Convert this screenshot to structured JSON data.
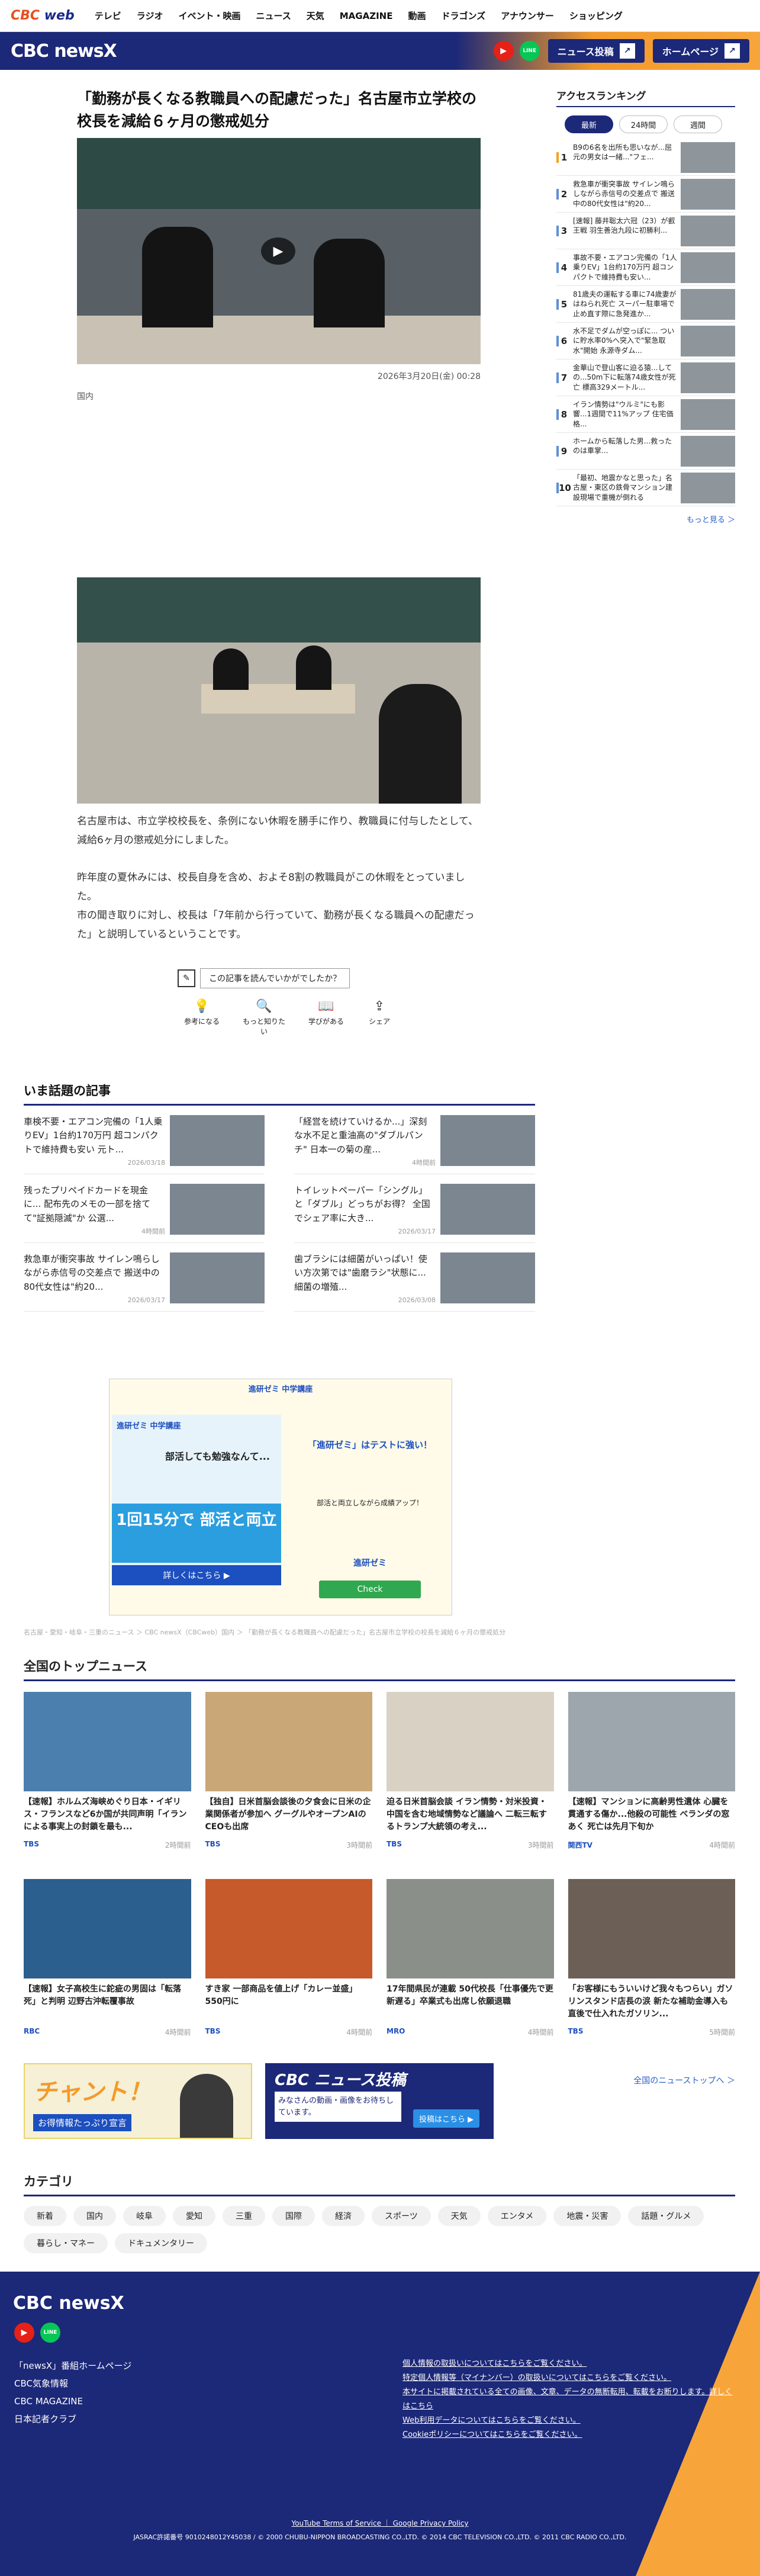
{
  "nav": {
    "logo": "CBC",
    "logo_web": "web",
    "items": [
      "テレビ",
      "ラジオ",
      "イベント・映画",
      "ニュース",
      "天気",
      "MAGAZINE",
      "動画",
      "ドラゴンズ",
      "アナウンサー",
      "ショッピング"
    ]
  },
  "header": {
    "logo": "CBC newsX",
    "youtube": "▶",
    "line": "LINE",
    "news_post": "ニュース投稿",
    "home": "ホームページ"
  },
  "article": {
    "title": "「勤務が長くなる教職員への配慮だった」名古屋市立学校の校長を減給６ヶ月の懲戒処分",
    "date": "2026年3月20日(金) 00:28",
    "category": "国内",
    "paragraphs": [
      "名古屋市は、市立学校校長を、条例にない休暇を勝手に作り、教職員に付与したとして、減給6ヶ月の懲戒処分にしました。",
      "昨年度の夏休みには、校長自身を含め、およそ8割の教職員がこの休暇をとっていました。",
      "市の聞き取りに対し、校長は「7年前から行っていて、勤務が長くなる職員への配慮だった」と説明しているということです。"
    ],
    "reaction_q": "この記事を読んでいかがでしたか？",
    "reactions": [
      "参考になる",
      "もっと知りたい",
      "学びがある",
      "シェア"
    ]
  },
  "sidebar": {
    "title": "アクセスランキング",
    "tabs": [
      "最新",
      "24時間",
      "週間"
    ],
    "ranking": [
      "B9の6名を出所も思いなが...屈元の男女は一緒...\"フェ...",
      "救急車が衝突事故 サイレン鳴らしながら赤信号の交差点で 搬送中の80代女性は\"約20...",
      "[速報] 藤井聡太六冠（23）が叡王戦 羽生善治九段に初勝利...",
      "事故不要・エアコン完備の「1人乗りEV」1台約170万円 超コンパクトで維持費も安い...",
      "81歳夫の運転する車に74歳妻がはねられ死亡 スーパー駐車場で止め直す際に急発進か...",
      "水不足でダムが空っぽに... ついに貯水率0%へ突入で\"緊急取水\"開始 永源寺ダム...",
      "金華山で登山客に迫る猿...しての...50m下に転落74歳女性が死亡 標高329メートル...",
      "イラン情勢は\"ウルミ\"にも影響...1週間で11%アップ 住宅価格...",
      "ホームから転落した男...救ったのは車掌...",
      "「最初、地震かなと思った」名古屋・東区の鉄骨マンション建設現場で重機が倒れる"
    ],
    "more": "もっと見る ＞"
  },
  "trending": {
    "title": "いま話題の記事",
    "items": [
      {
        "t": "車検不要・エアコン完備の「1人乗りEV」1台約170万円 超コンパクトで維持費も安い 元ト...",
        "d": "2026/03/18"
      },
      {
        "t": "「経営を続けていけるか...」深刻な水不足と重油高の\"ダブルパンチ\" 日本一の菊の産...",
        "d": "4時間前"
      },
      {
        "t": "残ったプリペイドカードを現金に... 配布先のメモの一部を捨てて\"証拠隠滅\"か 公選...",
        "d": "4時間前"
      },
      {
        "t": "トイレットペーパー「シングル」と「ダブル」どっちがお得？ 全国でシェア率に大き...",
        "d": "2026/03/17"
      },
      {
        "t": "救急車が衝突事故 サイレン鳴らしながら赤信号の交差点で 搬送中の80代女性は\"約20...",
        "d": "2026/03/17"
      },
      {
        "t": "歯ブラシには細菌がいっぱい！使い方次第では\"歯磨ラシ\"状態に... 細菌の増殖...",
        "d": "2026/03/08"
      }
    ]
  },
  "ad": {
    "brand": "進研ゼミ 中学講座",
    "headline": "部活しても勉強なんて...",
    "big": "1回15分で 部活と両立",
    "btn": "詳しくはこちら ▶",
    "right_title": "「進研ゼミ」はテストに強い！",
    "right_sub": "部活と両立しながら成績アップ！",
    "right_brand": "進研ゼミ",
    "check": "Check"
  },
  "breadcrumb": "名古屋・愛知・岐阜・三重のニュース ＞ CBC newsX（CBCweb）国内 ＞ 「勤務が長くなる教職員への配慮だった」名古屋市立学校の校長を減給６ヶ月の懲戒処分",
  "topnews": {
    "title": "全国のトップニュース",
    "items": [
      {
        "cap": "【速報】ホルムズ海峡めぐり日本・イギリス・フランスなど6か国が共同声明「イランによる事実上の封鎖を最も...",
        "src": "TBS",
        "time": "2時間前"
      },
      {
        "cap": "【独自】日米首脳会談後の夕食会に日米の企業関係者が参加へ グーグルやオープンAIのCEOも出席",
        "src": "TBS",
        "time": "3時間前"
      },
      {
        "cap": "迫る日米首脳会談 イラン情勢・対米投資・中国を含む地域情勢など議論へ 二転三転するトランプ大統領の考え...",
        "src": "TBS",
        "time": "3時間前"
      },
      {
        "cap": "【速報】マンションに高齢男性遺体 心臓を貫通する傷か...他殺の可能性 ベランダの窓あく 死亡は先月下旬か",
        "src": "関西TV",
        "time": "4時間前"
      },
      {
        "cap": "【速報】女子高校生に鉈疵の男固は「転落死」と判明 辺野古沖転覆事故",
        "src": "RBC",
        "time": "4時間前"
      },
      {
        "cap": "すき家 一部商品を値上げ「カレー並盛」550円に",
        "src": "TBS",
        "time": "4時間前"
      },
      {
        "cap": "17年間県民が連載 50代校長「仕事優先で更新遅る」卒業式も出席し依願退職",
        "src": "MRO",
        "time": "4時間前"
      },
      {
        "cap": "「お客様にもういいけど我々もつらい」ガソリンスタンド店長の涙 新たな補助金導入も直後で仕入れたガソリン...",
        "src": "TBS",
        "time": "5時間前"
      }
    ],
    "more": "全国のニューストップへ ＞"
  },
  "banners": {
    "chant": "チャント！",
    "chant_sub": "お得情報たっぷり宣言",
    "post_title": "CBC ニュース投稿",
    "post_sub": "みなさんの動画・画像をお待ちしています。",
    "post_btn": "投稿はこちら ▶"
  },
  "categories": {
    "title": "カテゴリ",
    "items": [
      "新着",
      "国内",
      "岐阜",
      "愛知",
      "三重",
      "国際",
      "経済",
      "スポーツ",
      "天気",
      "エンタメ",
      "地震・災害",
      "話題・グルメ",
      "暮らし・マネー",
      "ドキュメンタリー"
    ]
  },
  "footer": {
    "logo": "CBC newsX",
    "links": [
      "「newsX」番組ホームページ",
      "CBC気象情報",
      "CBC MAGAZINE",
      "日本記者クラブ"
    ],
    "right_links": [
      "個人情報の取扱いについてはこちらをご覧ください。",
      "特定個人情報等（マイナンバー）の取扱いについてはこちらをご覧ください。",
      "本サイトに掲載されている全ての画像、文章、データの無断転用、転載をお断りします。詳しくはこちら",
      "Web利用データについてはこちらをご覧ください。",
      "Cookieポリシーについてはこちらをご覧ください。"
    ],
    "tos": "YouTube Terms of Service ｜ Google Privacy Policy",
    "copyright": "JASRAC許諾番号 9010248012Y45038 / © 2000 CHUBU-NIPPON BROADCASTING CO.,LTD. © 2014 CBC TELEVISION CO.,LTD. © 2011 CBC RADIO CO.,LTD."
  }
}
